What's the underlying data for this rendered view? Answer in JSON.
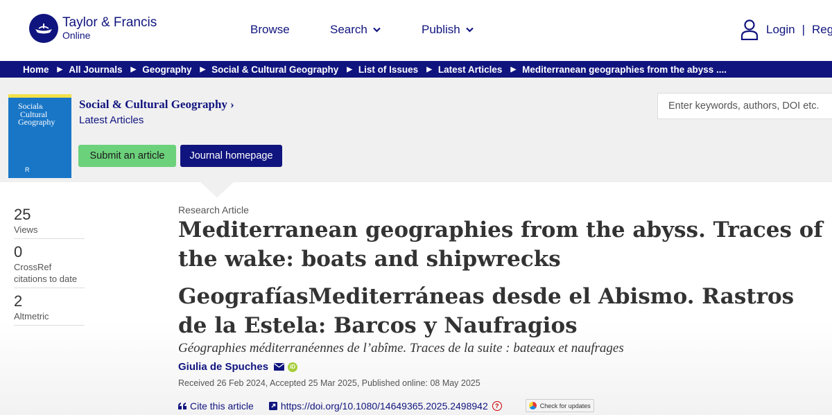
{
  "brand": {
    "line1": "Taylor & Francis",
    "line2": "Online"
  },
  "nav": {
    "browse": "Browse",
    "search": "Search",
    "publish": "Publish"
  },
  "account": {
    "login": "Login",
    "separator": "|",
    "register": "Reg"
  },
  "breadcrumbs": [
    "Home",
    "All Journals",
    "Geography",
    "Social & Cultural Geography",
    "List of Issues",
    "Latest Articles",
    "Mediterranean geographies from the abyss ...."
  ],
  "journal": {
    "title": "Social & Cultural Geography",
    "title_chevron": "›",
    "subtitle": "Latest Articles",
    "cover_text": "Social & Cultural Geography",
    "submit_label": "Submit an article",
    "homepage_label": "Journal homepage"
  },
  "search": {
    "placeholder": "Enter keywords, authors, DOI etc."
  },
  "metrics": [
    {
      "value": "25",
      "label": "Views"
    },
    {
      "value": "0",
      "label": "CrossRef citations to date"
    },
    {
      "value": "2",
      "label": "Altmetric"
    }
  ],
  "article": {
    "type": "Research Article",
    "title": "Mediterranean geographies from the abyss. Traces of the wake: boats and shipwrecks",
    "title_es": "GeografíasMediterráneas desde el Abismo. Rastros de la Estela: Barcos y Naufragios",
    "title_fr": "Géographies méditerranéennes de l’abîme. Traces de la suite : bateaux et naufrages",
    "author": "Giulia de Spuches",
    "dates": "Received 26 Feb 2024, Accepted 25 Mar 2025, Published online: 08 May 2025",
    "cite_label": "Cite this article",
    "doi": "https://doi.org/10.1080/14649365.2025.2498942",
    "check_updates": "Check for updates"
  },
  "colors": {
    "brand": "#10147e",
    "submit": "#6cd17b",
    "band": "#f0f0f0"
  },
  "icons": [
    "ship-logo-icon",
    "chevron-down-icon",
    "user-icon",
    "envelope-icon",
    "orcid-icon",
    "quote-icon",
    "external-link-icon",
    "doi-badge-icon",
    "crossmark-icon"
  ]
}
